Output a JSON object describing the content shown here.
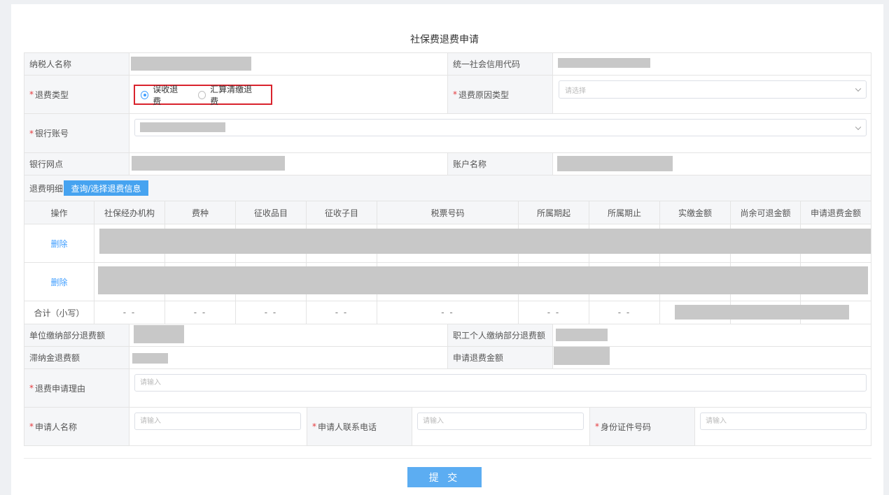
{
  "page": {
    "title": "社保费退费申请"
  },
  "form": {
    "taxpayer_name_label": "纳税人名称",
    "credit_code_label": "统一社会信用代码",
    "refund_type_label": "退费类型",
    "refund_type_options": [
      "误收退费",
      "汇算清缴退费"
    ],
    "refund_type_selected": "误收退费",
    "refund_reason_label": "退费原因类型",
    "refund_reason_placeholder": "请选择",
    "bank_account_label": "银行账号",
    "bank_branch_label": "银行网点",
    "account_name_label": "账户名称",
    "required_mark": "*"
  },
  "detail": {
    "label": "退费明细",
    "query_button": "查询/选择退费信息",
    "columns": [
      "操作",
      "社保经办机构",
      "费种",
      "征收品目",
      "征收子目",
      "税票号码",
      "所属期起",
      "所属期止",
      "实缴金额",
      "尚余可退金额",
      "申请退费金额"
    ],
    "rows": [
      {
        "action": "删除"
      },
      {
        "action": "删除"
      }
    ],
    "total_label": "合计（小写）",
    "total_placeholder": "- -"
  },
  "summary": {
    "unit_refund_label": "单位缴纳部分退费额",
    "personal_refund_label": "职工个人缴纳部分退费额",
    "late_fee_label": "滞纳金退费额",
    "apply_amount_label": "申请退费金额"
  },
  "reason": {
    "label": "退费申请理由",
    "placeholder": "请输入"
  },
  "applicant": {
    "name_label": "申请人名称",
    "phone_label": "申请人联系电话",
    "id_label": "身份证件号码",
    "placeholder": "请输入"
  },
  "actions": {
    "submit": "提 交"
  },
  "colors": {
    "accent": "#409eff",
    "required": "#e4393c",
    "highlight_border": "#d9232d"
  }
}
